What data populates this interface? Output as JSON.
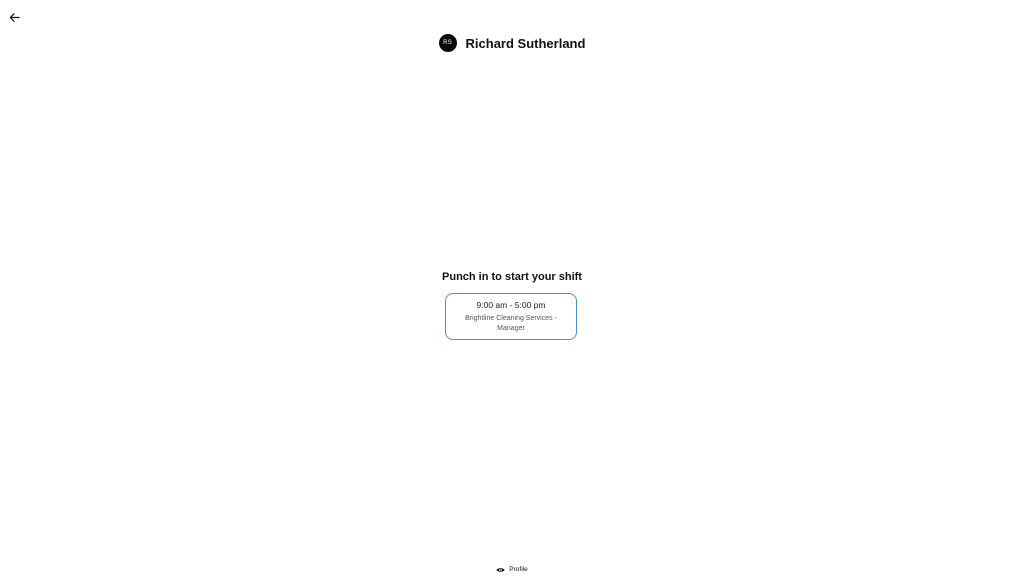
{
  "nav": {
    "back_icon": "arrow-left-icon"
  },
  "header": {
    "avatar_initials": "RS",
    "user_name": "Richard Sutherland"
  },
  "main": {
    "prompt": "Punch in to start your shift",
    "shift": {
      "time": "9:00 am - 5:00 pm",
      "description": "Brightline Cleaning Services - Manager"
    }
  },
  "footer": {
    "icon": "eye-icon",
    "label": "Profile"
  },
  "colors": {
    "card_border": "#4a8fd8",
    "avatar_bg": "#0a0a0a"
  }
}
